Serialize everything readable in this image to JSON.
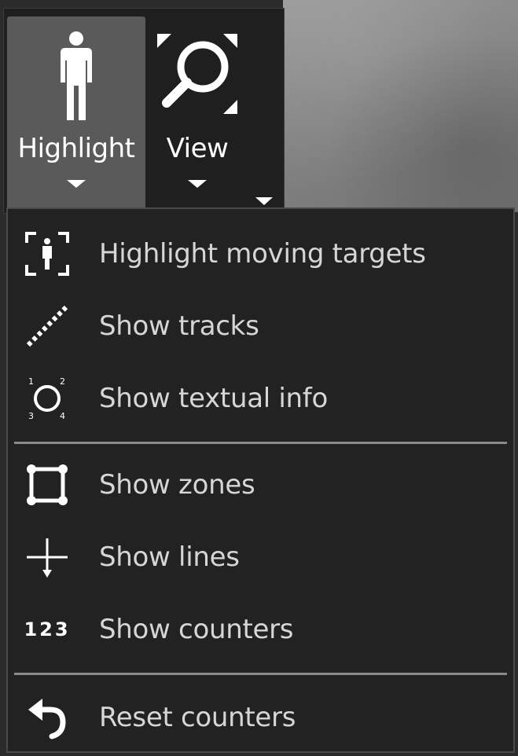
{
  "toolbar": {
    "highlight": {
      "label": "Highlight",
      "icon": "person-icon"
    },
    "view": {
      "label": "View",
      "icon": "magnifier-icon"
    },
    "more": {
      "icon": "chevron-down-icon"
    }
  },
  "menu": {
    "items": [
      {
        "label": "Highlight moving targets",
        "icon": "moving-target-icon"
      },
      {
        "label": "Show tracks",
        "icon": "tracks-icon"
      },
      {
        "label": "Show textual info",
        "icon": "textual-info-icon"
      },
      {
        "label": "Show zones",
        "icon": "zones-icon"
      },
      {
        "label": "Show lines",
        "icon": "lines-icon"
      },
      {
        "label": "Show counters",
        "icon": "counters-icon",
        "glyph": "123"
      },
      {
        "label": "Reset counters",
        "icon": "reset-icon"
      }
    ]
  },
  "colors": {
    "toolbar_bg": "#1f1f1f",
    "menu_bg": "#222222",
    "active_button_bg": "#5a5a5a",
    "menu_text": "#d6d6d6",
    "separator": "#8a8a8a"
  }
}
